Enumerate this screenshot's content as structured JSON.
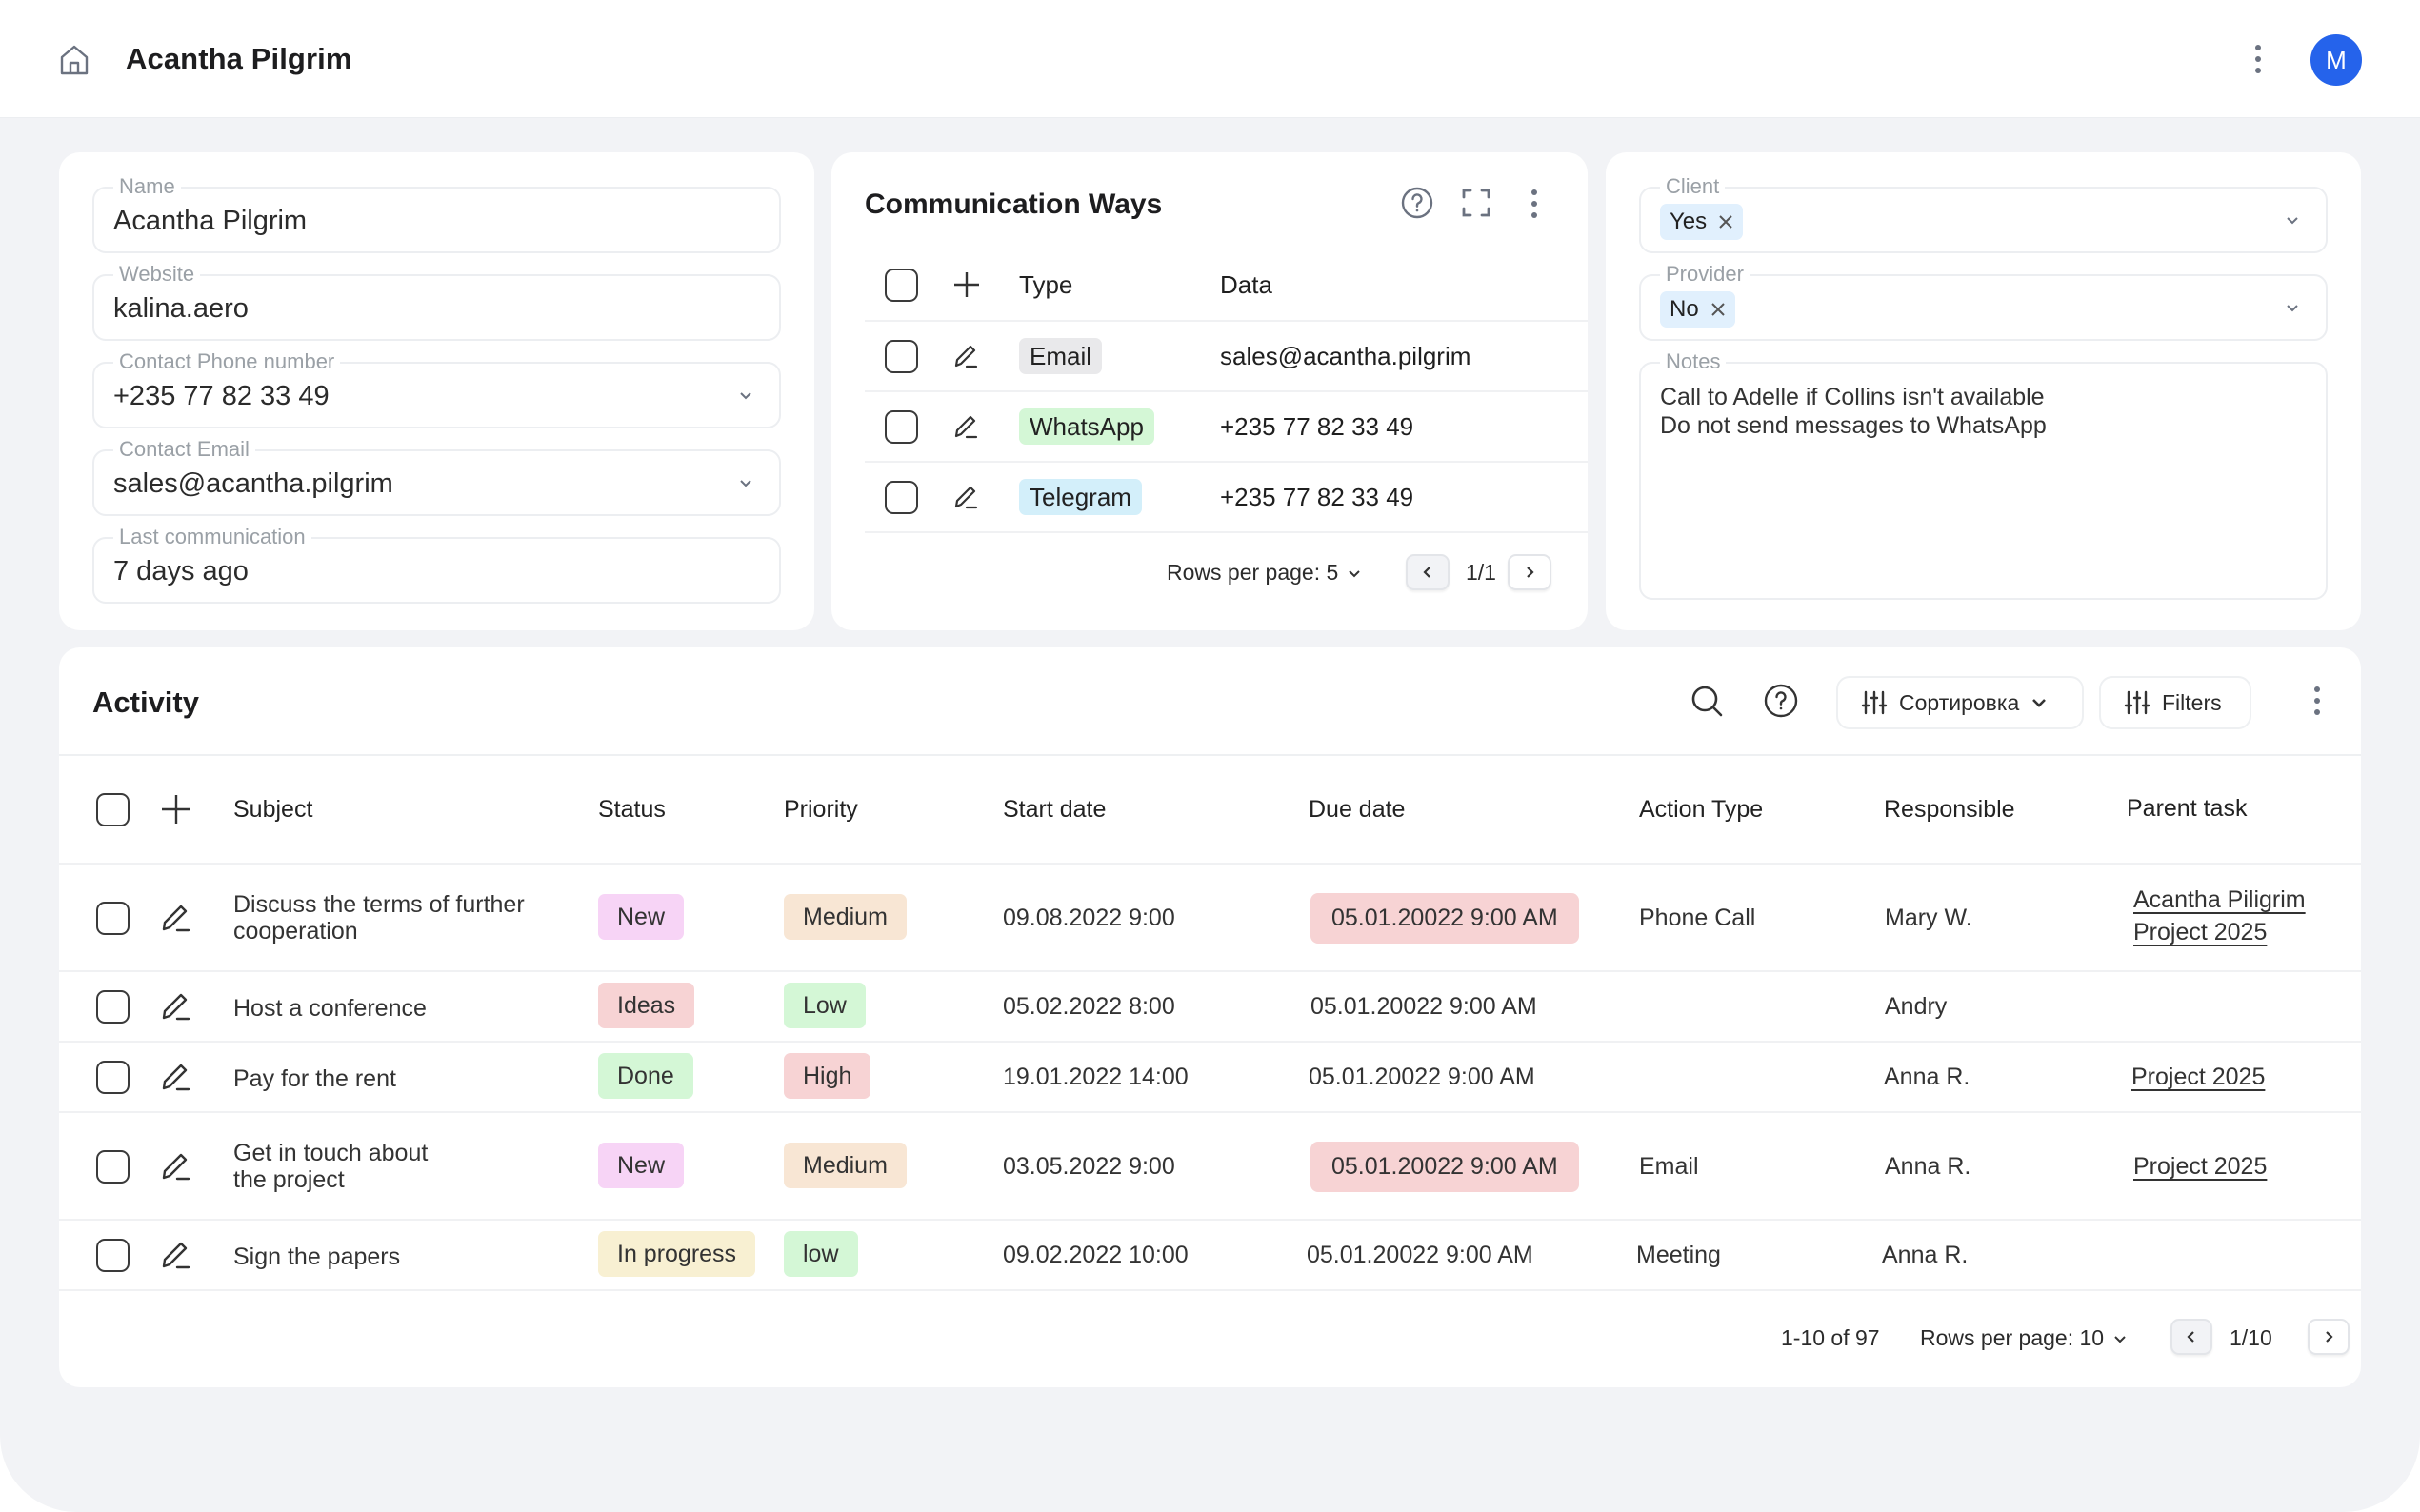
{
  "header": {
    "title": "Acantha Pilgrim",
    "home_icon": "home-icon",
    "menu_icon": "kebab-vertical-icon",
    "avatar_initial": "M",
    "avatar_color": "#2563eb"
  },
  "details": {
    "fields": [
      {
        "label": "Name",
        "value": "Acantha Pilgrim",
        "dropdown": false
      },
      {
        "label": "Website",
        "value": "kalina.aero",
        "dropdown": false
      },
      {
        "label": "Contact Phone number",
        "value": "+235 77 82 33 49",
        "dropdown": true
      },
      {
        "label": "Contact Email",
        "value": "sales@acantha.pilgrim",
        "dropdown": true
      },
      {
        "label": "Last communication",
        "value": "7 days ago",
        "dropdown": false
      }
    ]
  },
  "communication": {
    "title": "Communication Ways",
    "columns": {
      "type": "Type",
      "data": "Data"
    },
    "rows": [
      {
        "type": "Email",
        "type_color": "#e9e9eb",
        "data": "sales@acantha.pilgrim"
      },
      {
        "type": "WhatsApp",
        "type_color": "#d4f7d6",
        "data": "+235 77 82 33 49"
      },
      {
        "type": "Telegram",
        "type_color": "#d3effa",
        "data": "+235 77 82 33 49"
      }
    ],
    "rows_per_page_label": "Rows per page: 5",
    "page": "1/1"
  },
  "flags": {
    "client": {
      "label": "Client",
      "value": "Yes"
    },
    "provider": {
      "label": "Provider",
      "value": "No"
    },
    "notes": {
      "label": "Notes",
      "value": "Call to Adelle if Collins isn't available\nDo not send messages to WhatsApp"
    }
  },
  "activity": {
    "title": "Activity",
    "sort_label": "Сортировка",
    "filters_label": "Filters",
    "columns": {
      "subject": "Subject",
      "status": "Status",
      "priority": "Priority",
      "start": "Start date",
      "due": "Due date",
      "action_type": "Action Type",
      "responsible": "Responsible",
      "parent": "Parent task"
    },
    "rows": [
      {
        "subject": "Discuss the terms of further cooperation",
        "status": "New",
        "status_color": "#f7d4f6",
        "priority": "Medium",
        "priority_color": "#f8e6d4",
        "start": "09.08.2022 9:00",
        "due": "05.01.20022 9:00 AM",
        "due_overdue": true,
        "action_type": "Phone Call",
        "responsible": "Mary W.",
        "parent": "Acantha Piligrim Project 2025"
      },
      {
        "subject": "Host a conference",
        "status": "Ideas",
        "status_color": "#f7d3d4",
        "priority": "Low",
        "priority_color": "#d4f7d6",
        "start": "05.02.2022 8:00",
        "due": "05.01.20022 9:00 AM",
        "due_overdue": false,
        "action_type": "",
        "responsible": "Andry",
        "parent": ""
      },
      {
        "subject": "Pay for the rent",
        "status": "Done",
        "status_color": "#d4f7d6",
        "priority": "High",
        "priority_color": "#f7d3d4",
        "start": "19.01.2022 14:00",
        "due": "05.01.20022 9:00 AM",
        "due_overdue": false,
        "action_type": "",
        "responsible": "Anna R.",
        "parent": "Project 2025"
      },
      {
        "subject": "Get in touch about the project",
        "status": "New",
        "status_color": "#f7d4f6",
        "priority": "Medium",
        "priority_color": "#f8e6d4",
        "start": "03.05.2022 9:00",
        "due": "05.01.20022 9:00 AM",
        "due_overdue": true,
        "action_type": "Email",
        "responsible": "Anna R.",
        "parent": "Project 2025"
      },
      {
        "subject": "Sign the papers",
        "status": "In progress",
        "status_color": "#f8f0d2",
        "priority": "low",
        "priority_color": "#d4f7d6",
        "start": "09.02.2022 10:00",
        "due": "05.01.20022 9:00 AM",
        "due_overdue": false,
        "action_type": "Meeting",
        "responsible": "Anna R.",
        "parent": ""
      }
    ],
    "range_label": "1-10 of 97",
    "rows_per_page_label": "Rows per page: 10",
    "page": "1/10"
  }
}
